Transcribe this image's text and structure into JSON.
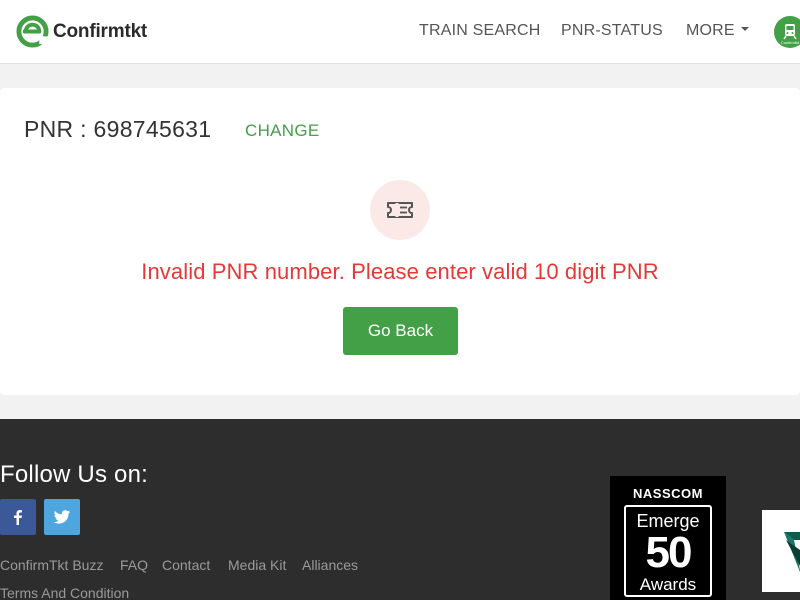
{
  "header": {
    "logo_text_main": "Confirm",
    "logo_text_suffix": "tkt",
    "nav": {
      "train_search": "TRAIN SEARCH",
      "pnr_status": "PNR-STATUS",
      "more": "MORE"
    },
    "app_badge_text": "Confirmtkt"
  },
  "card": {
    "pnr_label": "PNR : 698745631",
    "change_label": "CHANGE",
    "error_message": "Invalid PNR number. Please enter valid 10 digit PNR",
    "go_back_label": "Go Back"
  },
  "footer": {
    "follow_title": "Follow Us on:",
    "links": [
      "ConfirmTkt Buzz",
      "FAQ",
      "Contact",
      "Media Kit",
      "Alliances"
    ],
    "terms": "Terms And Condition",
    "award": {
      "org": "NASSCOM",
      "line1": "Emerge",
      "line2": "50",
      "line3": "Awards"
    }
  },
  "colors": {
    "brand_green": "#43a047",
    "error_red": "#e53935",
    "footer_bg": "#2d2d2d",
    "facebook": "#3b5998",
    "twitter": "#4da7de"
  },
  "icons": [
    "confirmtkt-logo-icon",
    "train-icon",
    "ticket-icon",
    "facebook-icon",
    "twitter-icon"
  ]
}
